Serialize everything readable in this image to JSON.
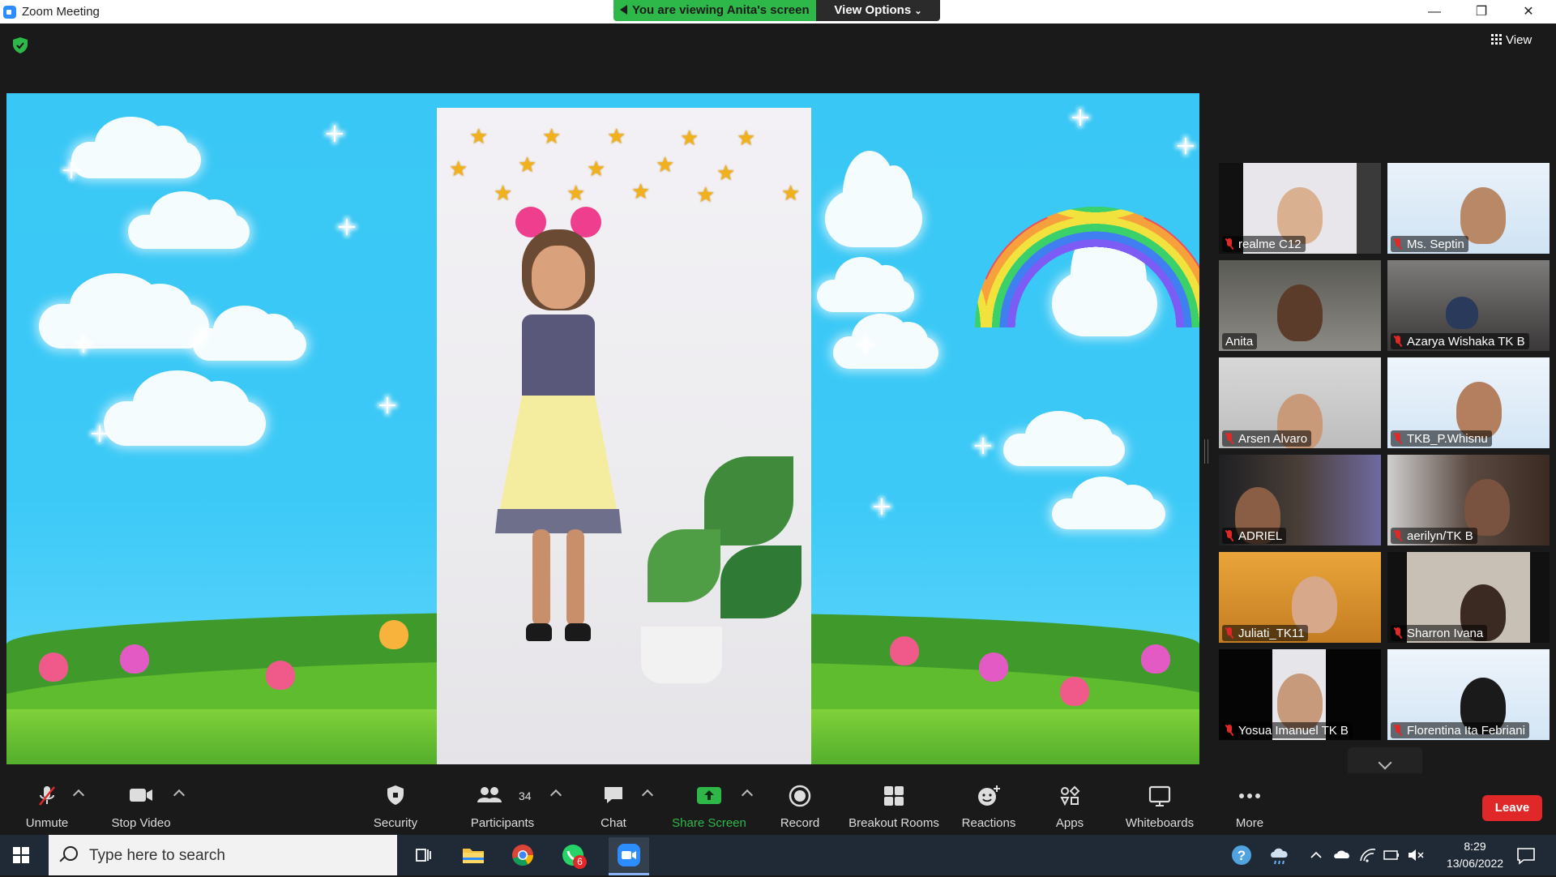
{
  "window": {
    "title": "Zoom Meeting",
    "controls": [
      "minimize",
      "restore",
      "close"
    ]
  },
  "banner": {
    "viewing_text": "You are viewing Anita's screen",
    "view_options_label": "View Options"
  },
  "meeting": {
    "view_label": "View",
    "encryption_icon": "shield-check-icon"
  },
  "gallery": {
    "active_speaker": "Anita",
    "tiles": [
      {
        "name": "realme C12",
        "muted": true
      },
      {
        "name": "Ms. Septin",
        "muted": true
      },
      {
        "name": "Anita",
        "muted": false
      },
      {
        "name": "Azarya Wishaka  TK B",
        "muted": true
      },
      {
        "name": "Arsen Alvaro",
        "muted": true
      },
      {
        "name": "TKB_P.Whisnu",
        "muted": true
      },
      {
        "name": "ADRIEL",
        "muted": true
      },
      {
        "name": "aerilyn/TK B",
        "muted": true
      },
      {
        "name": "Juliati_TK11",
        "muted": true
      },
      {
        "name": "Sharron Ivana",
        "muted": true
      },
      {
        "name": "Yosua Imanuel TK B",
        "muted": true
      },
      {
        "name": "Florentina Ita Febriani",
        "muted": true
      }
    ]
  },
  "toolbar": {
    "unmute": "Unmute",
    "stop_video": "Stop Video",
    "security": "Security",
    "participants": "Participants",
    "participants_count": "34",
    "chat": "Chat",
    "share_screen": "Share Screen",
    "record": "Record",
    "breakout_rooms": "Breakout Rooms",
    "reactions": "Reactions",
    "apps": "Apps",
    "whiteboards": "Whiteboards",
    "more": "More",
    "leave": "Leave"
  },
  "taskbar": {
    "search_placeholder": "Type here to search",
    "apps": [
      "task-view",
      "file-explorer",
      "chrome",
      "whatsapp",
      "zoom"
    ],
    "whatsapp_badge": "6",
    "time": "8:29",
    "date": "13/06/2022"
  },
  "colors": {
    "banner_green": "#2fb84a",
    "leave_red": "#e02828",
    "share_green": "#2fb84a",
    "active_speaker_border": "#e8e35a"
  }
}
